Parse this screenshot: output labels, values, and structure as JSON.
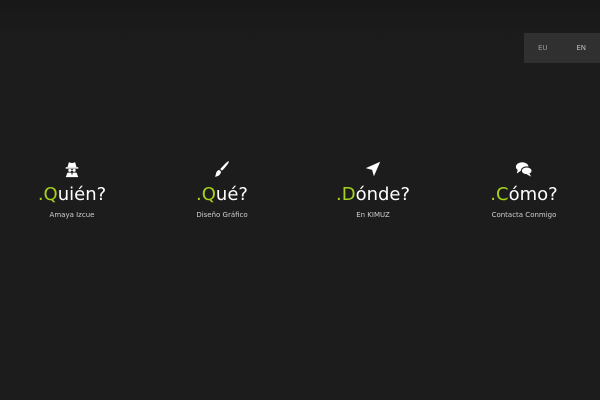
{
  "language_switch": {
    "options": [
      "EU",
      "EN"
    ],
    "selected": "EN"
  },
  "colors": {
    "accent": "#a6d11c",
    "background": "#1c1c1c",
    "lang_bar": "#303030"
  },
  "items": [
    {
      "icon": "spy-icon",
      "dot": ".",
      "first": "Q",
      "rest": "uién?",
      "subtitle": "Amaya Izcue"
    },
    {
      "icon": "paintbrush-icon",
      "dot": ".",
      "first": "Q",
      "rest": "ué?",
      "subtitle": "Diseño Gráfico"
    },
    {
      "icon": "location-arrow-icon",
      "dot": ".",
      "first": "D",
      "rest": "ónde?",
      "subtitle": "En KIMUZ"
    },
    {
      "icon": "chat-bubbles-icon",
      "dot": ".",
      "first": "C",
      "rest": "ómo?",
      "subtitle": "Contacta Conmigo"
    }
  ]
}
